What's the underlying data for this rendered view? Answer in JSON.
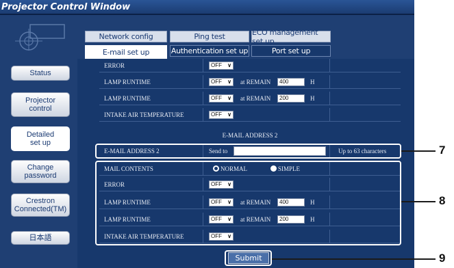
{
  "window": {
    "title": "Projector Control Window"
  },
  "sidebar": {
    "items": [
      {
        "label": "Status"
      },
      {
        "label": "Projector control"
      },
      {
        "label": "Detailed set up"
      },
      {
        "label": "Change password"
      },
      {
        "label": "Crestron Connected(TM)"
      },
      {
        "label": "日本語"
      }
    ]
  },
  "tabs": {
    "back_row": [
      "Network config",
      "Ping test",
      "ECO management set up"
    ],
    "front_row": [
      "E-mail set up",
      "Authentication set up",
      "Port set up"
    ],
    "selected": "E-mail set up"
  },
  "section1": {
    "rows": [
      {
        "label": "ERROR",
        "value": "OFF"
      },
      {
        "label": "LAMP RUNTIME",
        "value": "OFF",
        "remain_label": "at REMAIN",
        "remain_value": "400",
        "unit": "H"
      },
      {
        "label": "LAMP RUNTIME",
        "value": "OFF",
        "remain_label": "at REMAIN",
        "remain_value": "200",
        "unit": "H"
      },
      {
        "label": "INTAKE AIR TEMPERATURE",
        "value": "OFF"
      }
    ]
  },
  "section2": {
    "heading": "E-MAIL ADDRESS 2",
    "address_label": "E-MAIL ADDRESS 2",
    "send_to_label": "Send to",
    "send_to_value": "",
    "limit_note": "Up to 63 characters",
    "mail_contents_label": "MAIL CONTENTS",
    "options": [
      {
        "label": "NORMAL",
        "selected": true
      },
      {
        "label": "SIMPLE",
        "selected": false
      }
    ],
    "rows": [
      {
        "label": "ERROR",
        "value": "OFF"
      },
      {
        "label": "LAMP RUNTIME",
        "value": "OFF",
        "remain_label": "at REMAIN",
        "remain_value": "400",
        "unit": "H"
      },
      {
        "label": "LAMP RUNTIME",
        "value": "OFF",
        "remain_label": "at REMAIN",
        "remain_value": "200",
        "unit": "H"
      },
      {
        "label": "INTAKE AIR TEMPERATURE",
        "value": "OFF"
      }
    ]
  },
  "submit_label": "Submit",
  "callouts": [
    "7",
    "8",
    "9"
  ],
  "colors": {
    "window_bg": "#1f3f73",
    "content_bg": "#17386c",
    "highlight": "#ffffff"
  }
}
